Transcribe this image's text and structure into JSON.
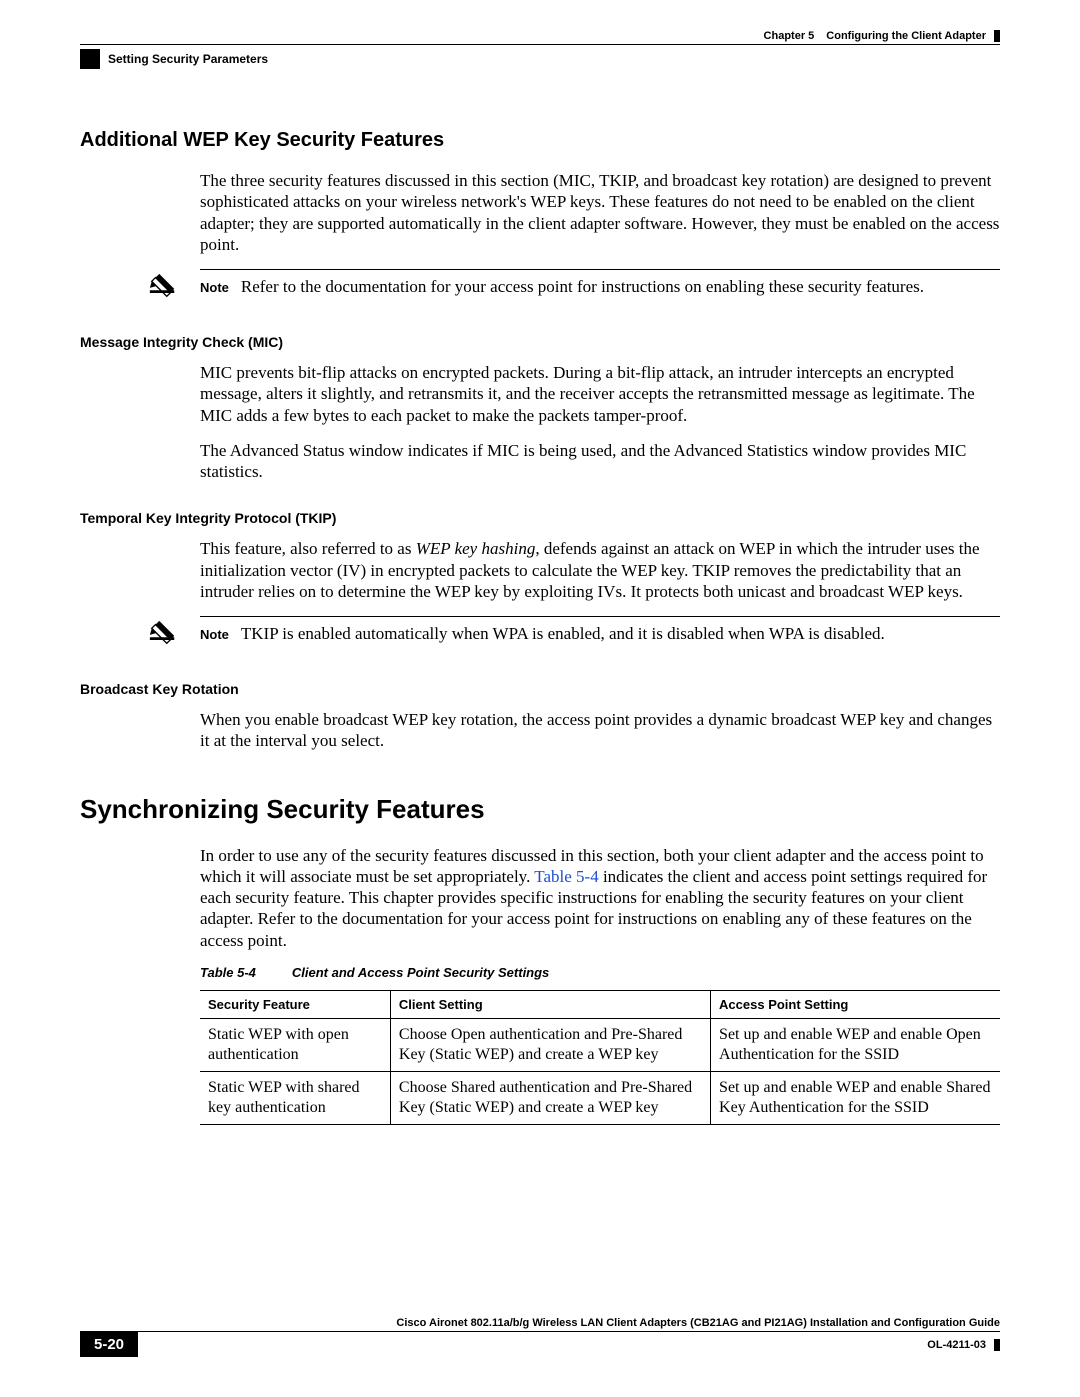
{
  "header": {
    "chapter_prefix": "Chapter 5",
    "chapter_title": "Configuring the Client Adapter",
    "section_crumb": "Setting Security Parameters"
  },
  "section1": {
    "title": "Additional WEP Key Security Features",
    "intro": "The three security features discussed in this section (MIC, TKIP, and broadcast key rotation) are designed to prevent sophisticated attacks on your wireless network's WEP keys. These features do not need to be enabled on the client adapter; they are supported automatically in the client adapter software. However, they must be enabled on the access point.",
    "note1_label": "Note",
    "note1_text": "Refer to the documentation for your access point for instructions on enabling these security features.",
    "mic_title": "Message Integrity Check (MIC)",
    "mic_p1": "MIC prevents bit-flip attacks on encrypted packets. During a bit-flip attack, an intruder intercepts an encrypted message, alters it slightly, and retransmits it, and the receiver accepts the retransmitted message as legitimate. The MIC adds a few bytes to each packet to make the packets tamper-proof.",
    "mic_p2": "The Advanced Status window indicates if MIC is being used, and the Advanced Statistics window provides MIC statistics.",
    "tkip_title": "Temporal Key Integrity Protocol (TKIP)",
    "tkip_pre": "This feature, also referred to as ",
    "tkip_italic": "WEP key hashing",
    "tkip_post": ", defends against an attack on WEP in which the intruder uses the initialization vector (IV) in encrypted packets to calculate the WEP key. TKIP removes the predictability that an intruder relies on to determine the WEP key by exploiting IVs. It protects both unicast and broadcast WEP keys.",
    "note2_label": "Note",
    "note2_text": "TKIP is enabled automatically when WPA is enabled, and it is disabled when WPA is disabled.",
    "bkr_title": "Broadcast Key Rotation",
    "bkr_p": "When you enable broadcast WEP key rotation, the access point provides a dynamic broadcast WEP key and changes it at the interval you select."
  },
  "section2": {
    "title": "Synchronizing Security Features",
    "p_pre": "In order to use any of the security features discussed in this section, both your client adapter and the access point to which it will associate must be set appropriately. ",
    "p_link": "Table 5-4",
    "p_post": " indicates the client and access point settings required for each security feature. This chapter provides specific instructions for enabling the security features on your client adapter. Refer to the documentation for your access point for instructions on enabling any of these features on the access point.",
    "table_label": "Table 5-4",
    "table_title": "Client and Access Point Security Settings",
    "columns": [
      "Security Feature",
      "Client Setting",
      "Access Point Setting"
    ],
    "rows": [
      {
        "feature": "Static WEP with open authentication",
        "client": "Choose Open authentication and Pre-Shared Key (Static WEP) and create a WEP key",
        "ap": "Set up and enable WEP and enable Open Authentication for the SSID"
      },
      {
        "feature": "Static WEP with shared key authentication",
        "client": "Choose Shared authentication and Pre-Shared Key (Static WEP) and create a WEP key",
        "ap": "Set up and enable WEP and enable Shared Key Authentication for the SSID"
      }
    ]
  },
  "footer": {
    "guide_title": "Cisco Aironet 802.11a/b/g Wireless LAN Client Adapters (CB21AG and PI21AG) Installation and Configuration Guide",
    "page_num": "5-20",
    "doc_num": "OL-4211-03"
  }
}
